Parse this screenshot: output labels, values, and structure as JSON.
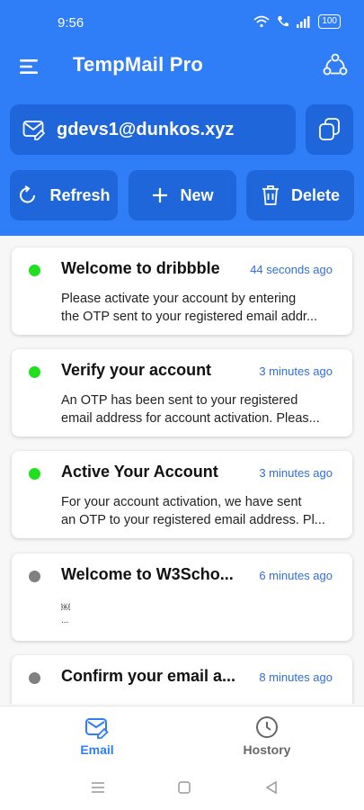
{
  "status_bar": {
    "time": "9:56",
    "battery": "100"
  },
  "header": {
    "title": "TempMail Pro"
  },
  "email": {
    "address": "gdevs1@dunkos.xyz"
  },
  "actions": {
    "refresh": "Refresh",
    "new": "New",
    "delete": "Delete"
  },
  "messages": [
    {
      "subject": "Welcome to dribbble",
      "time": "44 seconds ago",
      "line1": "Please activate your account by entering",
      "line2": "the OTP sent to your registered email addr...",
      "status": "unread"
    },
    {
      "subject": "Verify your account",
      "time": "3 minutes ago",
      "line1": "An OTP has been sent to your registered",
      "line2": "email address for account activation. Pleas...",
      "status": "unread"
    },
    {
      "subject": "Active Your Account",
      "time": "3 minutes ago",
      "line1": "For your account activation, we have sent",
      "line2": "an OTP to your registered email address. Pl...",
      "status": "unread"
    },
    {
      "subject": "Welcome to W3Scho...",
      "time": "6 minutes ago",
      "line1": "￼",
      "line2": "...",
      "status": "read"
    },
    {
      "subject": "Confirm your email a...",
      "time": "8 minutes ago",
      "line1": "￼",
      "line2": "",
      "status": "read"
    }
  ],
  "bottom_nav": {
    "email": "Email",
    "history": "Hostory"
  },
  "colors": {
    "primary": "#2f7df7",
    "button": "#1e66d9",
    "unread_dot": "#1fe01f",
    "read_dot": "#808080"
  }
}
